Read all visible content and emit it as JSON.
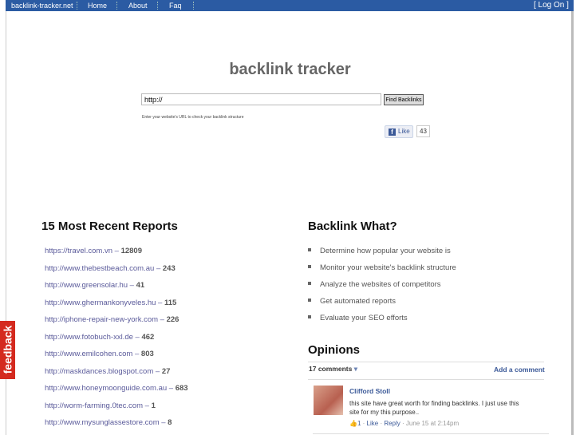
{
  "nav": {
    "brand": "backlink-tracker.net",
    "items": [
      "Home",
      "About",
      "Faq"
    ],
    "login": "[ Log On ]"
  },
  "header": {
    "title": "backlink tracker",
    "url_value": "http://",
    "find_button": "Find Backlinks",
    "hint": "Enter your website's URL to check your backlink structure",
    "like_label": "Like",
    "like_count": "43"
  },
  "reports": {
    "title": "15 Most Recent Reports",
    "items": [
      {
        "url": "https://travel.com.vn",
        "count": "12809"
      },
      {
        "url": "http://www.thebestbeach.com.au",
        "count": "243"
      },
      {
        "url": "http://www.greensolar.hu",
        "count": "41"
      },
      {
        "url": "http://www.ghermankonyveles.hu",
        "count": "115"
      },
      {
        "url": "http://iphone-repair-new-york.com",
        "count": "226"
      },
      {
        "url": "http://www.fotobuch-xxl.de",
        "count": "462"
      },
      {
        "url": "http://www.emilcohen.com",
        "count": "803"
      },
      {
        "url": "http://maskdances.blogspot.com",
        "count": "27"
      },
      {
        "url": "http://www.honeymoonguide.com.au",
        "count": "683"
      },
      {
        "url": "http://worm-farming.0tec.com",
        "count": "1"
      },
      {
        "url": "http://www.mysunglassestore.com",
        "count": "8"
      }
    ]
  },
  "what": {
    "title": "Backlink What?",
    "items": [
      "Determine how popular your website is",
      "Monitor your website's backlink structure",
      "Analyze the websites of competitors",
      "Get automated reports",
      "Evaluate your SEO efforts"
    ]
  },
  "opinions": {
    "title": "Opinions",
    "count": "17 comments",
    "add": "Add a comment",
    "comment": {
      "author": "Clifford Stoll",
      "text": "this site have great worth for finding backlinks. I just use this site for my this purpose..",
      "likes": "1",
      "like": "Like",
      "reply": "Reply",
      "time": "June 15 at 2:14pm"
    }
  },
  "feedback": "feedback"
}
